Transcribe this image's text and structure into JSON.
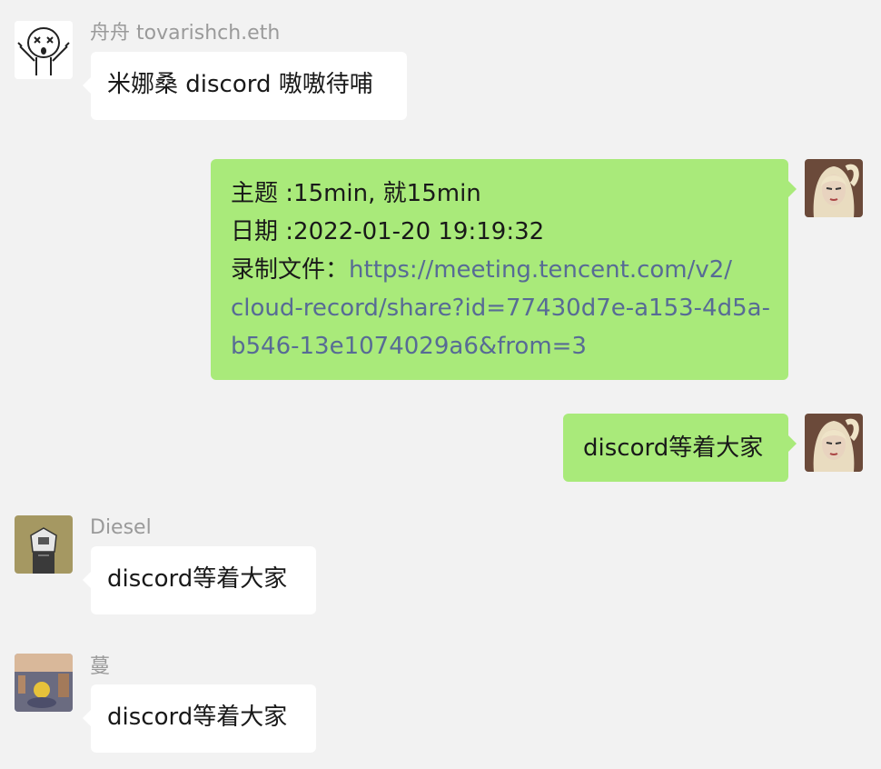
{
  "colors": {
    "background": "#f2f2f2",
    "incoming_bubble": "#ffffff",
    "outgoing_bubble": "#a9ea7a",
    "link": "#576b95",
    "sender_name": "#9a9a9a"
  },
  "messages": [
    {
      "direction": "incoming",
      "sender": "舟舟 tovarishch.eth",
      "avatar": "cartoon-face-avatar",
      "text": "米娜桑 discord 嗷嗷待哺"
    },
    {
      "direction": "outgoing",
      "avatar": "blonde-girl-avatar",
      "topic_line": "主题 :15min, 就15min",
      "date_line": "日期 :2022-01-20 19:19:32",
      "record_label": "录制文件：",
      "record_link_1": "https://meeting.tencent.com/v2/",
      "record_link_2": "cloud-record/share?id=77430d7e-a153-4d5a-",
      "record_link_3": "b546-13e1074029a6&from=3"
    },
    {
      "direction": "outgoing",
      "avatar": "blonde-girl-avatar",
      "text": "discord等着大家"
    },
    {
      "direction": "incoming",
      "sender": "Diesel",
      "avatar": "robot-avatar",
      "text": "discord等着大家"
    },
    {
      "direction": "incoming",
      "sender": "蔓",
      "avatar": "city-photo-avatar",
      "text": "discord等着大家"
    }
  ]
}
